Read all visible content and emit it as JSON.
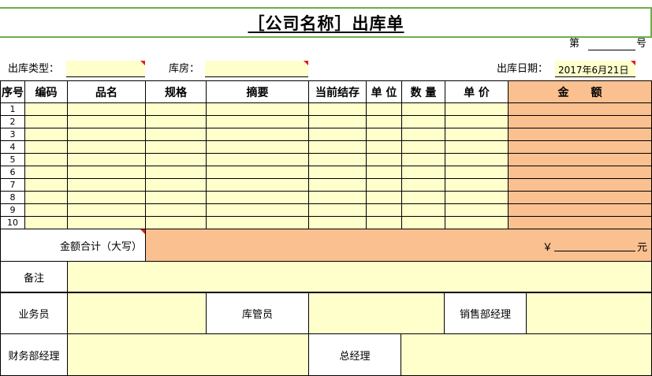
{
  "title": "［公司名称］出库单",
  "doc_number": {
    "prefix": "第",
    "suffix": "号"
  },
  "fields": {
    "out_type_label": "出库类型：",
    "warehouse_label": "库房：",
    "date_label": "出库日期：",
    "date_value": "2017年6月21日"
  },
  "table": {
    "columns": [
      "序号",
      "编码",
      "品名",
      "规格",
      "摘要",
      "当前结存",
      "单 位",
      "数 量",
      "单 价",
      "金　　额"
    ],
    "row_numbers": [
      "1",
      "2",
      "3",
      "4",
      "5",
      "6",
      "7",
      "8",
      "9",
      "10"
    ]
  },
  "total": {
    "label": "金额合计（大写）",
    "currency": "￥",
    "unit": "元"
  },
  "footer": {
    "remark_label": "备注",
    "salesperson_label": "业务员",
    "keeper_label": "库管员",
    "sales_manager_label": "销售部经理",
    "finance_manager_label": "财务部经理",
    "general_manager_label": "总经理"
  },
  "colors": {
    "field_fill": "#ffffcc",
    "amount_fill": "#fac090",
    "title_border": "#6aaf46",
    "note_marker": "#e02020"
  }
}
